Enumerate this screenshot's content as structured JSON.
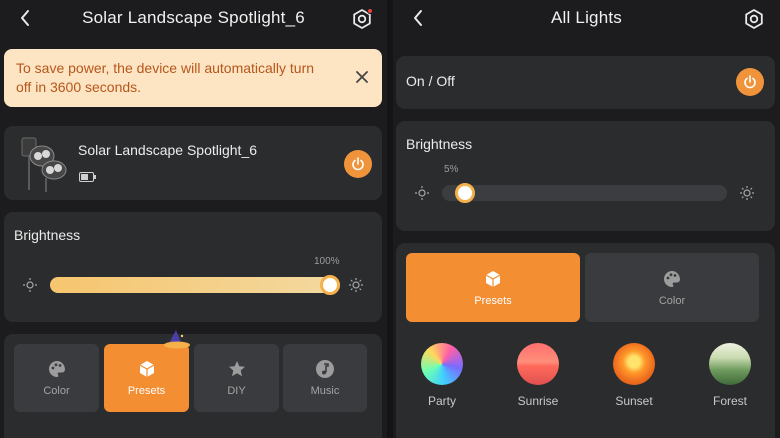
{
  "left": {
    "title": "Solar Landscape Spotlight_6",
    "banner_text": "To save power, the device will automatically turn off in 3600 seconds.",
    "device_name": "Solar Landscape Spotlight_6",
    "brightness_label": "Brightness",
    "brightness_value": "100%",
    "brightness_fraction": 1.0,
    "tabs": [
      {
        "label": "Color",
        "icon": "palette-icon"
      },
      {
        "label": "Presets",
        "icon": "cube-icon"
      },
      {
        "label": "DIY",
        "icon": "diy-star-icon"
      },
      {
        "label": "Music",
        "icon": "music-note-icon"
      }
    ],
    "active_tab": "Presets"
  },
  "right": {
    "title": "All Lights",
    "onoff_label": "On / Off",
    "brightness_label": "Brightness",
    "brightness_value": "5%",
    "brightness_fraction": 0.05,
    "tabs": [
      {
        "label": "Presets",
        "icon": "cube-icon"
      },
      {
        "label": "Color",
        "icon": "palette-icon"
      }
    ],
    "active_tab": "Presets",
    "presets": [
      {
        "label": "Party",
        "icon": "party-thumb"
      },
      {
        "label": "Sunrise",
        "icon": "sunrise-thumb"
      },
      {
        "label": "Sunset",
        "icon": "sunset-thumb"
      },
      {
        "label": "Forest",
        "icon": "forest-thumb"
      }
    ]
  },
  "colors": {
    "accent": "#f48e33",
    "banner_bg": "#fde5c4",
    "banner_text": "#b7561b",
    "card": "#2b2c2e",
    "background": "#1c1c1e"
  }
}
